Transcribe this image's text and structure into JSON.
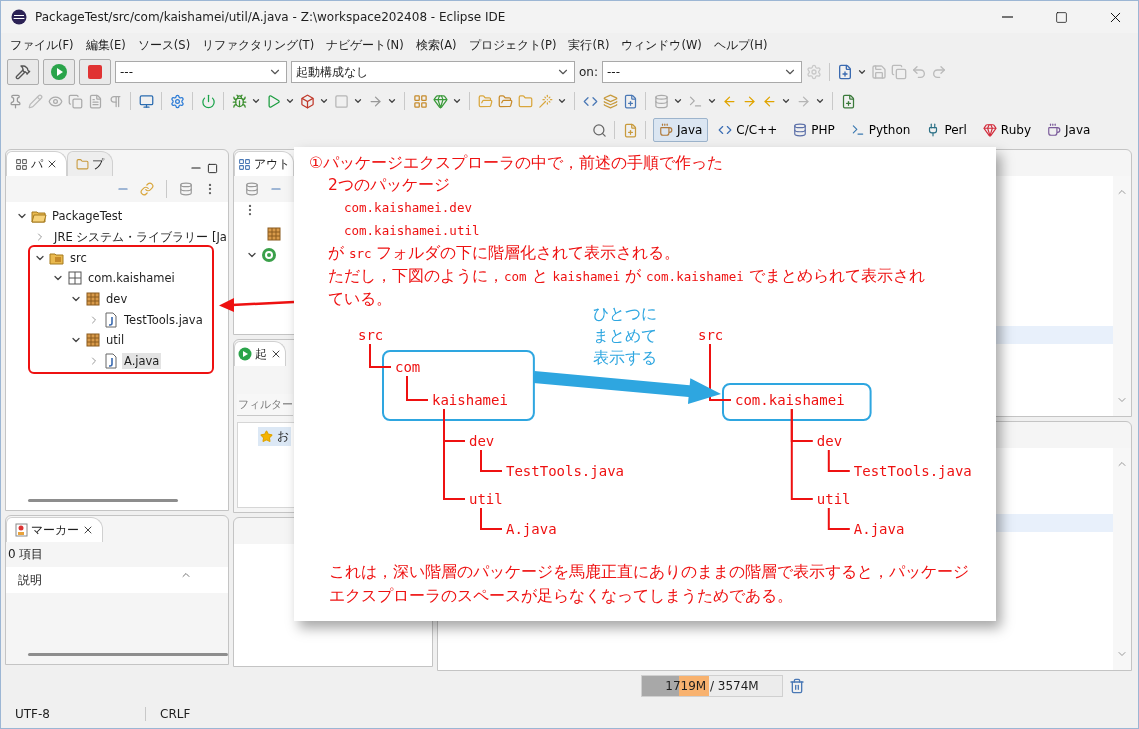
{
  "window": {
    "title": "PackageTest/src/com/kaishamei/util/A.java - Z:\\workspace202408 - Eclipse IDE"
  },
  "menu": [
    "ファイル(F)",
    "編集(E)",
    "ソース(S)",
    "リファクタリング(T)",
    "ナビゲート(N)",
    "検索(A)",
    "プロジェクト(P)",
    "実行(R)",
    "ウィンドウ(W)",
    "ヘルプ(H)"
  ],
  "toolbar": {
    "mode_combo": {
      "value": "---"
    },
    "launch_combo": {
      "value": "起動構成なし"
    },
    "on_label": "on:",
    "target_combo": {
      "value": "---"
    }
  },
  "perspectives": [
    {
      "label": "Java",
      "selected": true
    },
    {
      "label": "C/C++",
      "selected": false
    },
    {
      "label": "PHP",
      "selected": false
    },
    {
      "label": "Python",
      "selected": false
    },
    {
      "label": "Perl",
      "selected": false
    },
    {
      "label": "Ruby",
      "selected": false
    },
    {
      "label": "Java",
      "selected": false
    }
  ],
  "package_explorer": {
    "tabs": [
      {
        "label": "パ",
        "selected": true
      },
      {
        "label": "プ",
        "selected": false
      }
    ],
    "tree": [
      {
        "label": "PackageTest",
        "kind": "project",
        "expanded": true,
        "selected": false,
        "highlighted": false,
        "children": [
          {
            "label": "JRE システム・ライブラリー [Ja",
            "kind": "library",
            "expanded": false,
            "selected": false,
            "highlighted": false
          },
          {
            "label": "src",
            "kind": "source_folder",
            "expanded": true,
            "selected": false,
            "highlighted": true,
            "children": [
              {
                "label": "com.kaishamei",
                "kind": "package_root",
                "expanded": true,
                "selected": false,
                "highlighted": false,
                "children": [
                  {
                    "label": "dev",
                    "kind": "package",
                    "expanded": true,
                    "selected": false,
                    "highlighted": false,
                    "children": [
                      {
                        "label": "TestTools.java",
                        "kind": "java_file",
                        "expanded": false,
                        "selected": false,
                        "highlighted": false
                      }
                    ]
                  },
                  {
                    "label": "util",
                    "kind": "package",
                    "expanded": true,
                    "selected": false,
                    "highlighted": false,
                    "children": [
                      {
                        "label": "A.java",
                        "kind": "java_file",
                        "expanded": false,
                        "selected": true,
                        "highlighted": false
                      }
                    ]
                  }
                ]
              }
            ]
          }
        ]
      }
    ]
  },
  "outline": {
    "tab": "アウト"
  },
  "launch_panel": {
    "tab": "起",
    "filter": {
      "placeholder": "フィルター"
    },
    "favorites": "お"
  },
  "markers": {
    "tab": "マーカー",
    "count": "0 項目",
    "columns": [
      "説明"
    ]
  },
  "callout": {
    "paragraphs": [
      {
        "kind": "lead",
        "segments": [
          {
            "kind": "text",
            "text": "①パッケージエクスプローラの中で，前述の手順で作った"
          }
        ]
      },
      {
        "kind": "body",
        "segments": [
          {
            "kind": "text",
            "text": "2つのパッケージ"
          }
        ]
      },
      {
        "kind": "listing",
        "segments": [
          {
            "kind": "code",
            "text": "com.kaishamei.dev"
          }
        ]
      },
      {
        "kind": "listing",
        "segments": [
          {
            "kind": "code",
            "text": "com.kaishamei.util"
          }
        ]
      },
      {
        "kind": "body",
        "segments": [
          {
            "kind": "text",
            "text": "が "
          },
          {
            "kind": "code",
            "text": "src"
          },
          {
            "kind": "text",
            "text": " フォルダの下に階層化されて表示される。"
          }
        ]
      },
      {
        "kind": "body",
        "segments": [
          {
            "kind": "text",
            "text": "ただし，下図のように，"
          },
          {
            "kind": "code",
            "text": "com"
          },
          {
            "kind": "text",
            "text": " と "
          },
          {
            "kind": "code",
            "text": "kaishamei"
          },
          {
            "kind": "text",
            "text": " が "
          },
          {
            "kind": "code",
            "text": "com.kaishamei"
          },
          {
            "kind": "text",
            "text": " でまとめられて表示されている。"
          }
        ]
      }
    ],
    "diagram": {
      "trees": [
        {
          "label": "src",
          "boxed": false,
          "children": [
            {
              "label": "com",
              "boxed": true,
              "children": [
                {
                  "label": "kaishamei",
                  "boxed": true,
                  "children": [
                    {
                      "label": "dev",
                      "boxed": false,
                      "children": [
                        {
                          "label": "TestTools.java",
                          "boxed": false
                        }
                      ]
                    },
                    {
                      "label": "util",
                      "boxed": false,
                      "children": [
                        {
                          "label": "A.java",
                          "boxed": false
                        }
                      ]
                    }
                  ]
                }
              ]
            }
          ]
        },
        {
          "label": "src",
          "boxed": false,
          "children": [
            {
              "label": "com.kaishamei",
              "boxed": true,
              "children": [
                {
                  "label": "dev",
                  "boxed": false,
                  "children": [
                    {
                      "label": "TestTools.java",
                      "boxed": false
                    }
                  ]
                },
                {
                  "label": "util",
                  "boxed": false,
                  "children": [
                    {
                      "label": "A.java",
                      "boxed": false
                    }
                  ]
                }
              ]
            }
          ]
        }
      ],
      "arrow_label": "ひとつにまとめて表示する"
    },
    "conclusion": "これは，深い階層のパッケージを馬鹿正直にありのままの階層で表示すると，パッケージエクスプローラのスペースが足らなくなってしまうためである。"
  },
  "status_bar": {
    "encoding": "UTF-8",
    "line_ending": "CRLF",
    "heap": {
      "text": "1719M / 3574M",
      "level": 0.48
    }
  }
}
